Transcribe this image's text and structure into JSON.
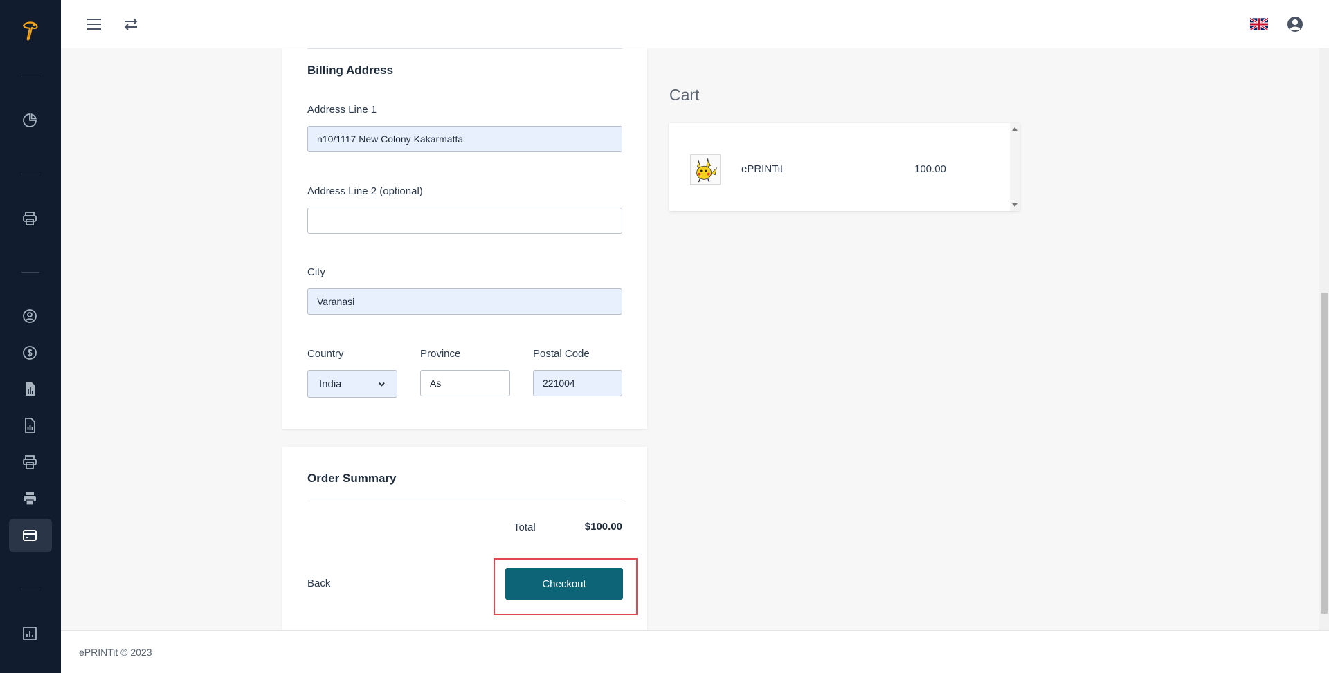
{
  "billing": {
    "title": "Billing Address",
    "address1_label": "Address Line 1",
    "address1_value": "n10/1117 New Colony Kakarmatta",
    "address2_label": "Address Line 2",
    "address2_optional": "(optional)",
    "address2_value": "",
    "city_label": "City",
    "city_value": "Varanasi",
    "country_label": "Country",
    "country_value": "India",
    "province_label": "Province",
    "province_value": "As",
    "postal_label": "Postal Code",
    "postal_value": "221004"
  },
  "order": {
    "title": "Order Summary",
    "total_label": "Total",
    "total_value": "$100.00",
    "back_label": "Back",
    "checkout_label": "Checkout"
  },
  "cart": {
    "title": "Cart",
    "items": [
      {
        "name": "ePRINTit",
        "price": "100.00"
      }
    ]
  },
  "footer": {
    "text": "ePRINTit © 2023"
  },
  "colors": {
    "sidebar": "#111c2e",
    "accent": "#0e6477",
    "highlight": "#e0484f",
    "autofill": "#e8f0fe"
  },
  "icons": {
    "sidebar": [
      "logo-icon",
      "pie-chart-icon",
      "printer-icon",
      "user-circle-icon",
      "dollar-icon",
      "document-chart-icon",
      "report-icon",
      "printer-outline-icon",
      "printer-filled-icon",
      "credit-card-icon",
      "bar-chart-icon"
    ],
    "topbar": [
      "menu-icon",
      "swap-icon",
      "uk-flag-icon",
      "account-icon"
    ]
  }
}
